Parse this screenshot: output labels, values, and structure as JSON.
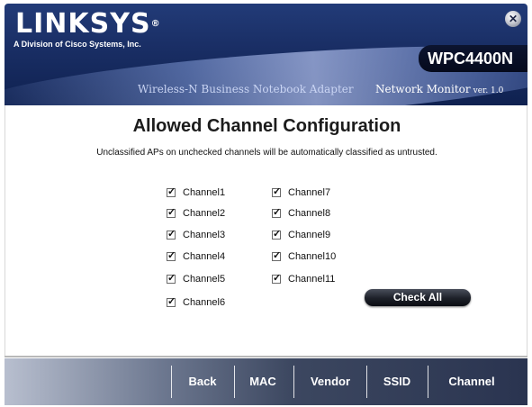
{
  "header": {
    "logo_text": "LINKSYS",
    "logo_mark": "®",
    "division": "A Division of Cisco Systems, Inc.",
    "model": "WPC4400N",
    "subtitle": "Wireless-N Business Notebook Adapter",
    "app_name": "Network Monitor",
    "version": "ver. 1.0",
    "close_icon": "close-icon"
  },
  "main": {
    "title": "Allowed Channel Configuration",
    "description": "Unclassified APs on unchecked channels will be automatically classified as untrusted.",
    "channels_left": [
      {
        "label": "Channel1",
        "checked": true
      },
      {
        "label": "Channel2",
        "checked": true
      },
      {
        "label": "Channel3",
        "checked": true
      },
      {
        "label": "Channel4",
        "checked": true
      },
      {
        "label": "Channel5",
        "checked": true
      },
      {
        "label": "Channel6",
        "checked": true
      }
    ],
    "channels_right": [
      {
        "label": "Channel7",
        "checked": true
      },
      {
        "label": "Channel8",
        "checked": true
      },
      {
        "label": "Channel9",
        "checked": true
      },
      {
        "label": "Channel10",
        "checked": true
      },
      {
        "label": "Channel11",
        "checked": true
      }
    ],
    "check_all_label": "Check All"
  },
  "nav": {
    "items": [
      "Back",
      "MAC",
      "Vendor",
      "SSID",
      "Channel"
    ]
  },
  "colors": {
    "header_blue": "#1a2f66",
    "button_dark": "#1d2028",
    "nav_gradient_end": "#2a3450"
  }
}
